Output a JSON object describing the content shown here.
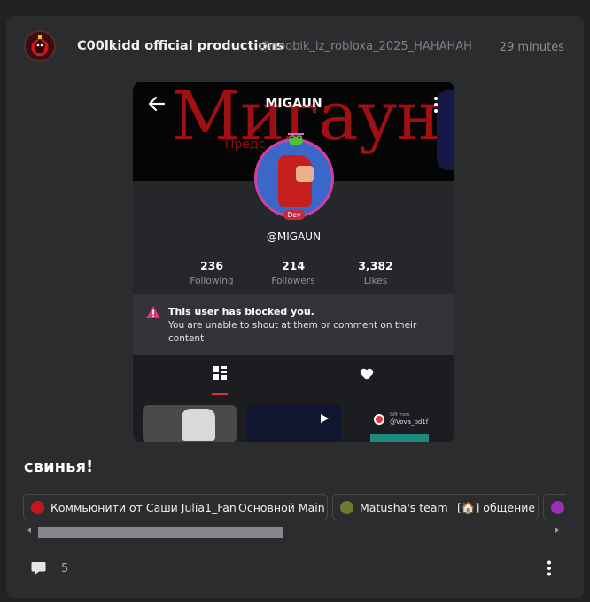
{
  "post": {
    "author": "C00lkidd official productions",
    "handle": "@noobik_iz_robloxа_2025_HAHAHAH",
    "time": "29 minutes",
    "text": "свинья!",
    "comment_count": "5"
  },
  "screenshot": {
    "banner_big": "Мигаун",
    "banner_small": "Предс",
    "title": "MIGAUN",
    "username": "@MIGAUN",
    "badge": "Dev",
    "stats": [
      {
        "value": "236",
        "label": "Following"
      },
      {
        "value": "214",
        "label": "Followers"
      },
      {
        "value": "3,382",
        "label": "Likes"
      }
    ],
    "blocked_title": "This user has blocked you.",
    "blocked_text": "You are unable to shout at them or comment on their content",
    "thumb3_small1": "Gift from",
    "thumb3_small2": "@Vova_bd1f"
  },
  "communities": [
    {
      "name": "Коммьюнити от Саши Julia1_Fan",
      "channel": "Основной Main",
      "icon_color": "#c01822"
    },
    {
      "name": "Matusha's team",
      "channel": "[🏠] общение",
      "icon_color": "#6c7b2e"
    },
    {
      "name": "",
      "channel": "",
      "icon_color": "#9a2fb6"
    }
  ],
  "colors": {
    "background": "#202224",
    "card": "#2a2c2e",
    "accent_red": "#e0312c",
    "muted_text": "#7c8087"
  },
  "icons": {
    "comment": "speech-bubble-icon",
    "menu": "vertical-dots-icon",
    "back": "arrow-left-icon",
    "grid": "grid-icon",
    "heart": "heart-icon",
    "warning": "warning-triangle-icon"
  }
}
